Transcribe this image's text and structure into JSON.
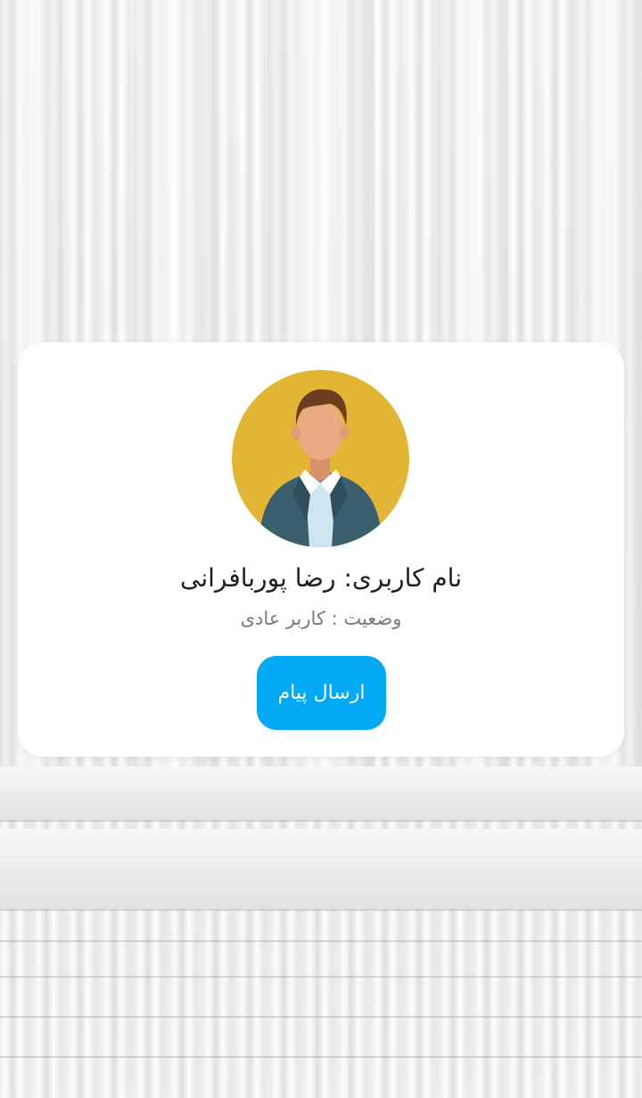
{
  "profile": {
    "avatar_icon": "user-avatar-icon",
    "username_label": "نام کاربری: رضا پوربافرانی",
    "status_label": "وضعیت : کاربر عادی"
  },
  "actions": {
    "send_message_label": "ارسال پیام"
  },
  "colors": {
    "accent": "#03a9f4",
    "avatar_background": "#e2b634",
    "card_background": "#ffffff"
  }
}
